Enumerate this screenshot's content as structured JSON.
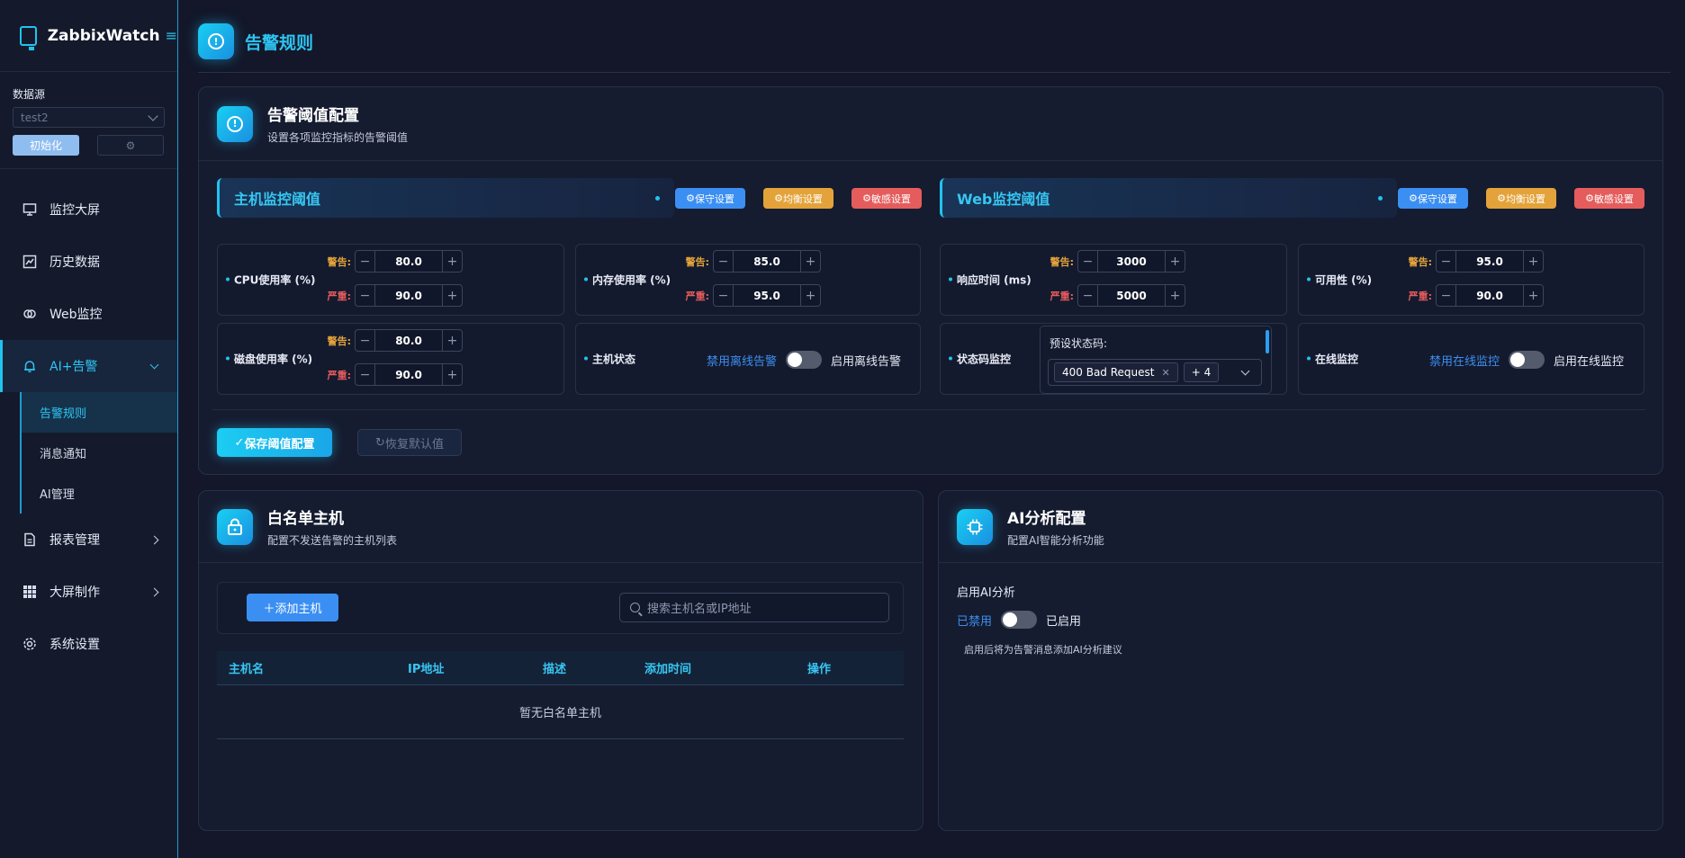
{
  "app": {
    "name": "ZabbixWatch"
  },
  "datasource": {
    "label": "数据源",
    "selected": "test2",
    "init_label": "初始化",
    "gear_label": "⚙"
  },
  "nav": {
    "items": [
      {
        "label": "监控大屏",
        "icon": "monitor-icon"
      },
      {
        "label": "历史数据",
        "icon": "chart-icon"
      },
      {
        "label": "Web监控",
        "icon": "link-icon"
      },
      {
        "label": "AI+告警",
        "icon": "bell-icon"
      },
      {
        "label": "报表管理",
        "icon": "document-icon"
      },
      {
        "label": "大屏制作",
        "icon": "grid-icon"
      },
      {
        "label": "系统设置",
        "icon": "gear-icon"
      }
    ],
    "sub": [
      "告警规则",
      "消息通知",
      "AI管理"
    ]
  },
  "page": {
    "title": "告警规则"
  },
  "threshold": {
    "title": "告警阈值配置",
    "subtitle": "设置各项监控指标的告警阈值",
    "host_section": "主机监控阈值",
    "web_section": "Web监控阈值",
    "presets": {
      "conservative": "保守设置",
      "balanced": "均衡设置",
      "sensitive": "敏感设置"
    },
    "warn_label": "警告:",
    "crit_label": "严重:",
    "cpu": {
      "label": "CPU使用率 (%)",
      "warn": "80.0",
      "crit": "90.0"
    },
    "mem": {
      "label": "内存使用率 (%)",
      "warn": "85.0",
      "crit": "95.0"
    },
    "disk": {
      "label": "磁盘使用率 (%)",
      "warn": "80.0",
      "crit": "90.0"
    },
    "host_status": {
      "label": "主机状态",
      "off": "禁用离线告警",
      "on": "启用离线告警",
      "enabled": false
    },
    "resp": {
      "label": "响应时间 (ms)",
      "warn": "3000",
      "crit": "5000"
    },
    "avail": {
      "label": "可用性 (%)",
      "warn": "95.0",
      "crit": "90.0"
    },
    "status_code": {
      "label": "状态码监控",
      "preset_label": "预设状态码:",
      "tag": "400 Bad Request",
      "more": "+ 4"
    },
    "online": {
      "label": "在线监控",
      "off": "禁用在线监控",
      "on": "启用在线监控",
      "enabled": false
    },
    "save": "保存阈值配置",
    "reset": "恢复默认值"
  },
  "whitelist": {
    "title": "白名单主机",
    "subtitle": "配置不发送告警的主机列表",
    "add": "添加主机",
    "search_placeholder": "搜索主机名或IP地址",
    "columns": [
      "主机名",
      "IP地址",
      "描述",
      "添加时间",
      "操作"
    ],
    "empty": "暂无白名单主机"
  },
  "ai": {
    "title": "AI分析配置",
    "subtitle": "配置AI智能分析功能",
    "enable_label": "启用AI分析",
    "off": "已禁用",
    "on": "已启用",
    "enabled": false,
    "hint": "启用后将为告警消息添加AI分析建议"
  },
  "colors": {
    "accent": "#22c3ef",
    "primary": "#3b8ff2",
    "warn": "#e3a33a",
    "danger": "#e55c5c",
    "bg": "#131729"
  }
}
